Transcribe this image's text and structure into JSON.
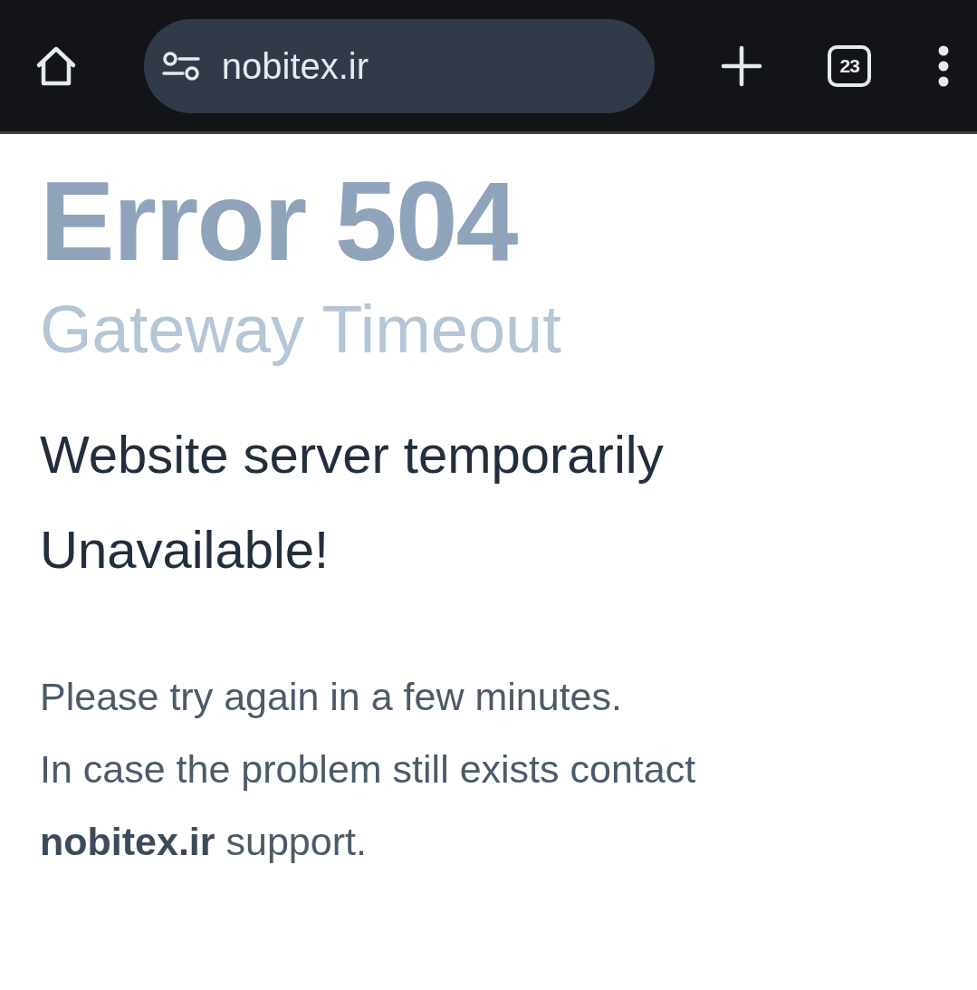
{
  "browser_bar": {
    "url": "nobitex.ir",
    "tab_count": "23"
  },
  "page": {
    "title": "Error 504",
    "subtitle": "Gateway Timeout",
    "message_lines": [
      "Website server temporarily",
      "Unavailable!"
    ],
    "help_lines": [
      "Please try again in a few minutes.",
      "In case the problem still exists contact",
      "**nobitex.ir** support."
    ]
  }
}
